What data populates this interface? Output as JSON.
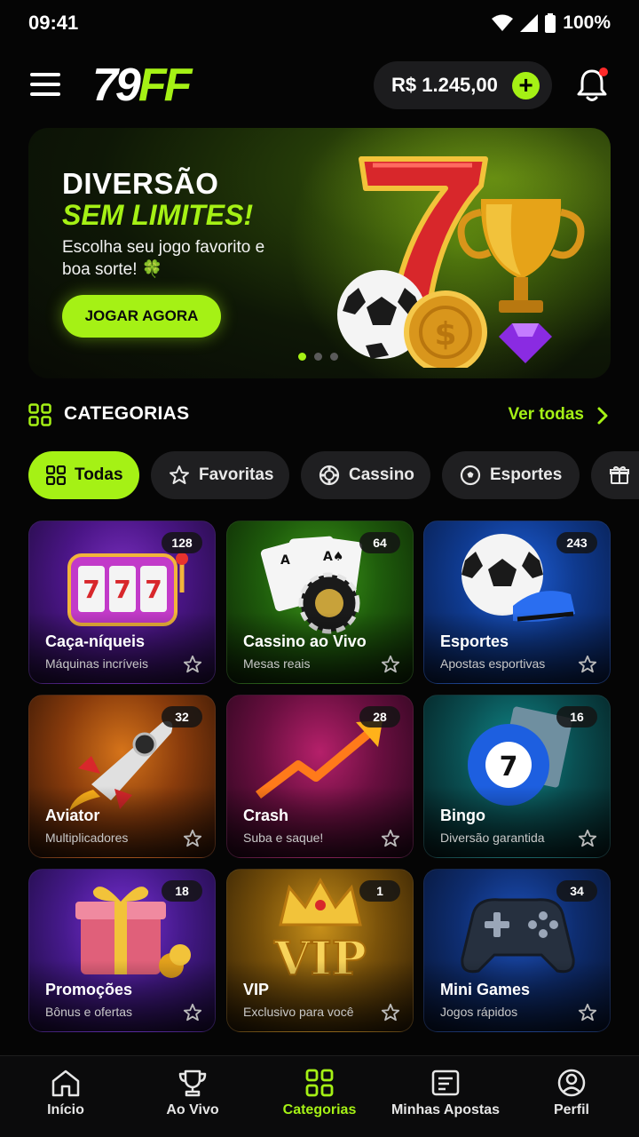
{
  "status_bar": {
    "time": "09:41",
    "battery": "100%"
  },
  "header": {
    "logo_white": "79",
    "logo_green": "FF",
    "balance": "R$ 1.245,00"
  },
  "hero": {
    "title_line1": "DIVERSÃO",
    "title_line2": "SEM LIMITES!",
    "subtitle": "Escolha seu jogo favorito e boa sorte! 🍀",
    "cta": "JOGAR AGORA"
  },
  "categories": {
    "title": "CATEGORIAS",
    "see_all": "Ver todas",
    "chips": [
      {
        "label": "Todas",
        "icon": "grid-icon",
        "active": true
      },
      {
        "label": "Favoritas",
        "icon": "star-icon"
      },
      {
        "label": "Cassino",
        "icon": "chip-icon"
      },
      {
        "label": "Esportes",
        "icon": "soccer-ball-icon"
      },
      {
        "label": "",
        "icon": "gift-icon"
      }
    ],
    "cards": [
      {
        "name": "Caça-níqueis",
        "desc": "Máquinas incríveis",
        "count": "128",
        "icon": "slot-machine-icon"
      },
      {
        "name": "Cassino ao Vivo",
        "desc": "Mesas reais",
        "count": "64",
        "icon": "cards-icon"
      },
      {
        "name": "Esportes",
        "desc": "Apostas esportivas",
        "count": "243",
        "icon": "soccer-ball-icon"
      },
      {
        "name": "Aviator",
        "desc": "Multiplicadores",
        "count": "32",
        "icon": "rocket-icon"
      },
      {
        "name": "Crash",
        "desc": "Suba e saque!",
        "count": "28",
        "icon": "arrow-up-icon"
      },
      {
        "name": "Bingo",
        "desc": "Diversão garantida",
        "count": "16",
        "icon": "bingo-ball-icon"
      },
      {
        "name": "Promoções",
        "desc": "Bônus e ofertas",
        "count": "18",
        "icon": "gift-icon"
      },
      {
        "name": "VIP",
        "desc": "Exclusivo para você",
        "count": "1",
        "icon": "crown-icon"
      },
      {
        "name": "Mini Games",
        "desc": "Jogos rápidos",
        "count": "34",
        "icon": "gamepad-icon"
      }
    ]
  },
  "nav": [
    {
      "label": "Início",
      "icon": "home-icon"
    },
    {
      "label": "Ao Vivo",
      "icon": "trophy-icon"
    },
    {
      "label": "Categorias",
      "icon": "grid-icon",
      "active": true
    },
    {
      "label": "Minhas Apostas",
      "icon": "ticket-icon"
    },
    {
      "label": "Perfil",
      "icon": "user-icon"
    }
  ],
  "colors": {
    "accent": "#a5f115",
    "background": "#050505",
    "surface": "#1f1f21"
  }
}
